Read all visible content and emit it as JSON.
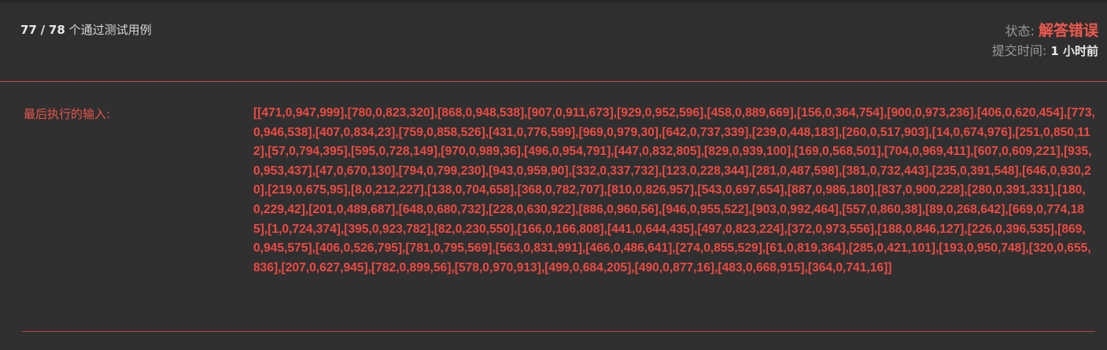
{
  "summary": {
    "passed": "77",
    "separator": "/",
    "total": "78",
    "suffix": "个通过测试用例"
  },
  "status": {
    "label": "状态:",
    "value": "解答错误",
    "value_color": "#f0594f"
  },
  "submit_time": {
    "label": "提交时间:",
    "value": "1 小时前"
  },
  "last_input": {
    "label": "最后执行的输入:",
    "value": "[[471,0,947,999],[780,0,823,320],[868,0,948,538],[907,0,911,673],[929,0,952,596],[458,0,889,669],[156,0,364,754],[900,0,973,236],[406,0,620,454],[773,0,946,538],[407,0,834,23],[759,0,858,526],[431,0,776,599],[969,0,979,30],[642,0,737,339],[239,0,448,183],[260,0,517,903],[14,0,674,976],[251,0,850,112],[57,0,794,395],[595,0,728,149],[970,0,989,36],[496,0,954,791],[447,0,832,805],[829,0,939,100],[169,0,568,501],[704,0,969,411],[607,0,609,221],[935,0,953,437],[47,0,670,130],[794,0,799,230],[943,0,959,90],[332,0,337,732],[123,0,228,344],[281,0,487,598],[381,0,732,443],[235,0,391,548],[646,0,930,20],[219,0,675,95],[8,0,212,227],[138,0,704,658],[368,0,782,707],[810,0,826,957],[543,0,697,654],[887,0,986,180],[837,0,900,228],[280,0,391,331],[180,0,229,42],[201,0,489,687],[648,0,680,732],[228,0,630,922],[886,0,960,56],[946,0,955,522],[903,0,992,464],[557,0,860,38],[89,0,268,642],[669,0,774,185],[1,0,724,374],[395,0,923,782],[82,0,230,550],[166,0,166,808],[441,0,644,435],[497,0,823,224],[372,0,973,556],[188,0,846,127],[226,0,396,535],[869,0,945,575],[406,0,526,795],[781,0,795,569],[563,0,831,991],[466,0,486,641],[274,0,855,529],[61,0,819,364],[285,0,421,101],[193,0,950,748],[320,0,655,836],[207,0,627,945],[782,0,899,56],[578,0,970,913],[499,0,684,205],[490,0,877,16],[483,0,668,915],[364,0,741,16]]",
    "color": "#ee4a43"
  },
  "colors": {
    "background": "#303030",
    "accent_red": "#e8554b",
    "divider": "#c94a44"
  }
}
